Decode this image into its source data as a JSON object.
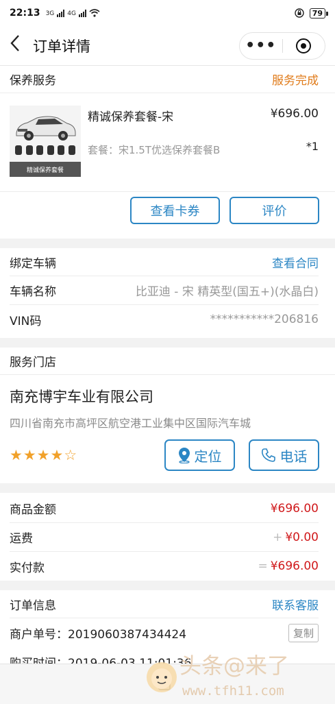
{
  "status": {
    "time": "22:13",
    "net1": "3G",
    "net2": "4G",
    "battery": "79"
  },
  "nav": {
    "title": "订单详情"
  },
  "service": {
    "title": "保养服务",
    "status": "服务完成"
  },
  "product": {
    "name": "精诚保养套餐-宋",
    "price": "¥696.00",
    "desc": "套餐：宋1.5T优选保养套餐B",
    "qty": "*1",
    "thumb_caption": "精诚保养套餐"
  },
  "actions": {
    "coupon": "查看卡券",
    "review": "评价"
  },
  "vehicle": {
    "title": "绑定车辆",
    "contract": "查看合同",
    "name_label": "车辆名称",
    "name_value": "比亚迪 - 宋 精英型(国五+)(水晶白)",
    "vin_label": "VIN码",
    "vin_value": "***********206816"
  },
  "store": {
    "title": "服务门店",
    "name": "南充博宇车业有限公司",
    "address": "四川省南充市高坪区航空港工业集中区国际汽车城",
    "rating": 4,
    "rating_max": 5,
    "locate": "定位",
    "phone": "电话"
  },
  "amount": {
    "goods_label": "商品金额",
    "goods_value": "¥696.00",
    "freight_label": "运费",
    "freight_sign": "+",
    "freight_value": "¥0.00",
    "paid_label": "实付款",
    "paid_sign": "=",
    "paid_value": "¥696.00"
  },
  "order": {
    "title": "订单信息",
    "contact": "联系客服",
    "merchant_no": "商户单号：2019060387434424",
    "copy": "复制",
    "buy_time": "购买时间：2019-06-03 11:01:36"
  },
  "watermark": {
    "text": "头条@来了",
    "url": "www.tfh11.com"
  },
  "colors": {
    "accent": "#2b86c4",
    "status": "#e07b1a",
    "price": "#d0191b",
    "star": "#f1a12a"
  }
}
